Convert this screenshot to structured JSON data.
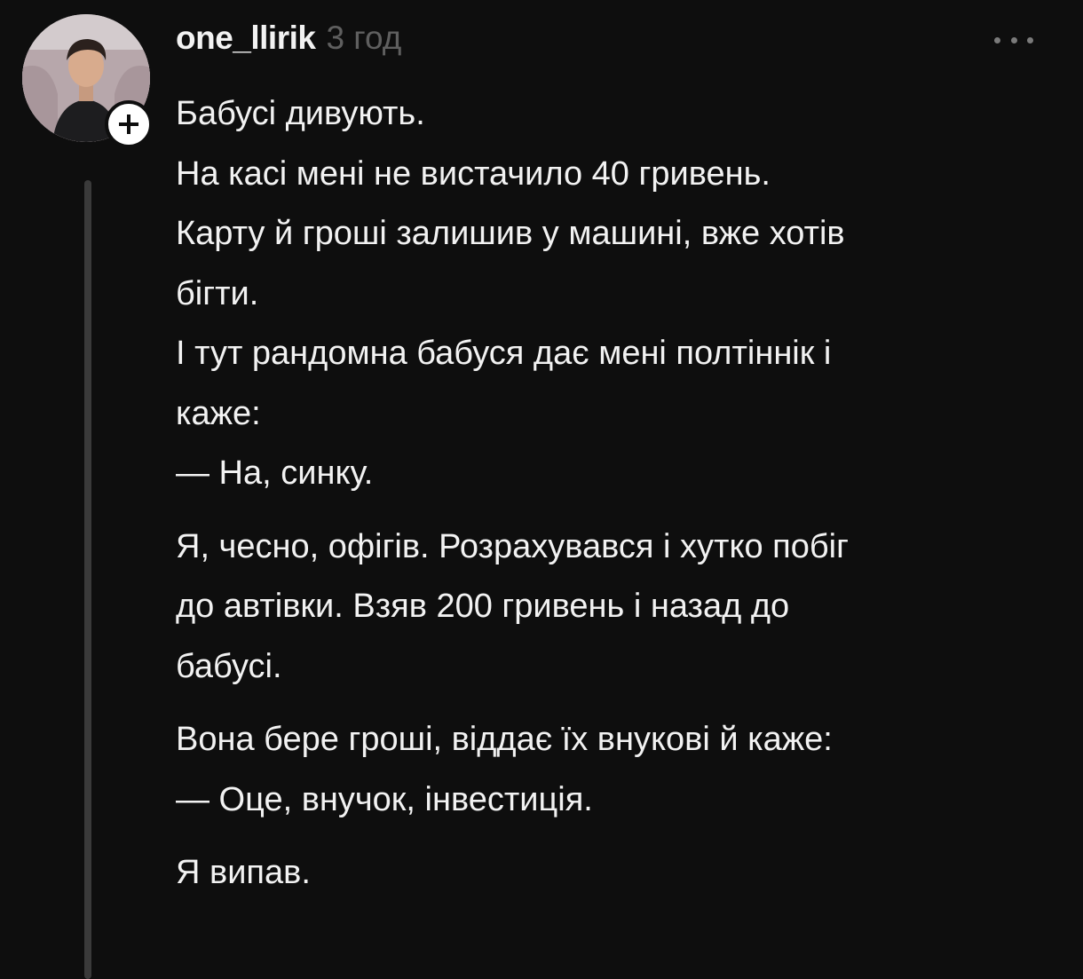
{
  "post": {
    "author": {
      "username": "one_llirik",
      "timestamp": "3 год",
      "avatar_icon": "user-avatar-photo",
      "follow_icon": "plus-icon"
    },
    "menu_icon": "more-horizontal-icon",
    "body": {
      "p1": {
        "l1": "Бабусі дивують.",
        "l2": "На касі мені не вистачило 40 гривень.",
        "l3": "Карту й гроші залишив у машині, вже хотів",
        "l4": "бігти.",
        "l5": "І тут рандомна бабуся дає мені полтіннік і",
        "l6": "каже:",
        "l7": "— На, синку."
      },
      "p2": {
        "l1": "Я, чесно, офігів. Розрахувався і хутко побіг",
        "l2": "до автівки. Взяв 200 гривень і назад до",
        "l3": "бабусі."
      },
      "p3": {
        "l1": "Вона бере гроші, віддає їх внукові й каже:",
        "l2": "— Оце, внучок, інвестиція."
      },
      "p4": {
        "l1": "Я випав."
      }
    }
  },
  "colors": {
    "background": "#0e0e0e",
    "text": "#f2f2f2",
    "muted": "#5f5f5f",
    "thread_line": "#3a3a3a"
  }
}
